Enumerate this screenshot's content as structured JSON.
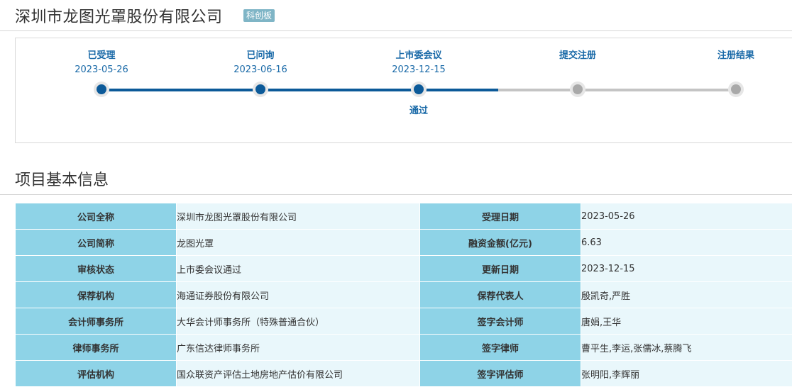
{
  "header": {
    "company_name": "深圳市龙图光罩股份有限公司",
    "board_badge": "科创板"
  },
  "progress": {
    "steps": [
      {
        "label": "已受理",
        "date": "2023-05-26",
        "sub": "",
        "status": "done"
      },
      {
        "label": "已问询",
        "date": "2023-06-16",
        "sub": "",
        "status": "done"
      },
      {
        "label": "上市委会议",
        "date": "2023-12-15",
        "sub": "通过",
        "status": "done"
      },
      {
        "label": "提交注册",
        "date": "",
        "sub": "",
        "status": "pending"
      },
      {
        "label": "注册结果",
        "date": "",
        "sub": "",
        "status": "pending"
      }
    ],
    "colors": {
      "done": "#0c5a99",
      "pending": "#c4c4c4"
    }
  },
  "section": {
    "title": "项目基本信息"
  },
  "info_rows": [
    {
      "k1": "公司全称",
      "v1": "深圳市龙图光罩股份有限公司",
      "k2": "受理日期",
      "v2": "2023-05-26"
    },
    {
      "k1": "公司简称",
      "v1": "龙图光罩",
      "k2": "融资金额(亿元)",
      "v2": "6.63"
    },
    {
      "k1": "审核状态",
      "v1": "上市委会议通过",
      "k2": "更新日期",
      "v2": "2023-12-15"
    },
    {
      "k1": "保荐机构",
      "v1": "海通证券股份有限公司",
      "k2": "保荐代表人",
      "v2": "殷凯奇,严胜"
    },
    {
      "k1": "会计师事务所",
      "v1": "大华会计师事务所（特殊普通合伙）",
      "k2": "签字会计师",
      "v2": "唐娟,王华"
    },
    {
      "k1": "律师事务所",
      "v1": "广东信达律师事务所",
      "k2": "签字律师",
      "v2": "曹平生,李运,张儒冰,蔡腾飞"
    },
    {
      "k1": "评估机构",
      "v1": "国众联资产评估土地房地产估价有限公司",
      "k2": "签字评估师",
      "v2": "张明阳,李辉丽"
    }
  ]
}
